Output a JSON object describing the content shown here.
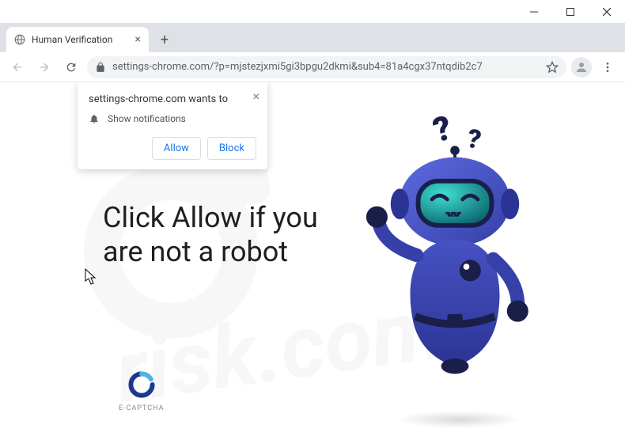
{
  "window": {
    "title": "Human Verification"
  },
  "toolbar": {
    "url": "settings-chrome.com/?p=mjstezjxmi5gi3bpgu2dkmi&sub4=81a4cgx37ntqdib2c7"
  },
  "prompt": {
    "origin": "settings-chrome.com wants to",
    "permission": "Show notifications",
    "allow": "Allow",
    "block": "Block"
  },
  "page": {
    "heading": "Click Allow if you are not a robot",
    "ecaptcha": "E-CAPTCHA"
  },
  "watermark": "pcrisk.com"
}
